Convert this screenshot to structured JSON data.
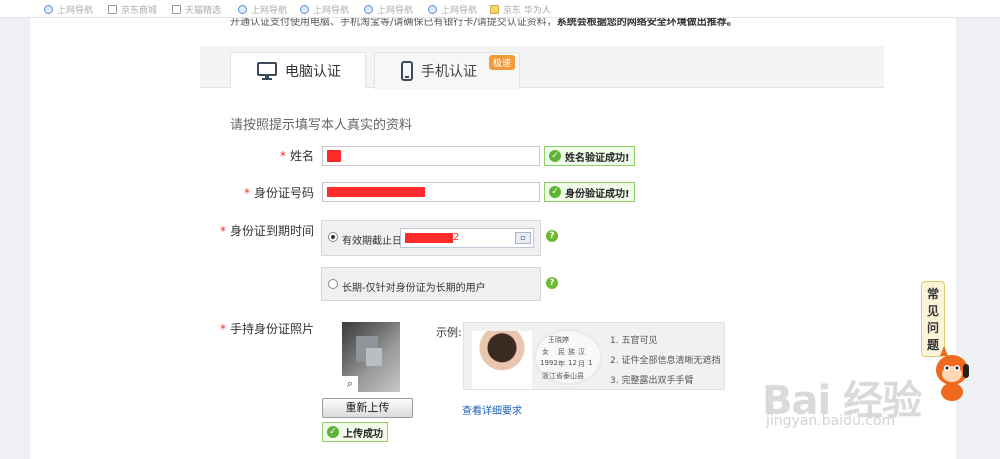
{
  "topbar": {
    "items": [
      "上网导航",
      "京东商城",
      "天猫精选",
      "上网导航",
      "上网导航",
      "上网导航",
      "上网导航",
      "京东 华为人"
    ]
  },
  "notice": {
    "text": "开通认证支付使用电脑、手机淘宝等/请确保已有银行卡/请提交认证资料，",
    "bold": "系统会根据您的网络安全环境做出推荐。"
  },
  "tabs": [
    {
      "label": "电脑认证",
      "icon": "monitor-icon",
      "active": true
    },
    {
      "label": "手机认证",
      "icon": "phone-icon",
      "active": false,
      "badge": "极速"
    }
  ],
  "form": {
    "intro": "请按照提示填写本人真实的资料",
    "name": {
      "label": "姓名",
      "required": "*",
      "status": "姓名验证成功!"
    },
    "id_number": {
      "label": "身份证号码",
      "required": "*",
      "status": "身份验证成功!"
    },
    "expiry": {
      "label": "身份证到期时间",
      "required": "*",
      "option_date": {
        "label": "有效期截止日",
        "selected": true,
        "suffix": "2"
      },
      "option_long": {
        "label": "长期-仅针对身份证为长期的用户",
        "selected": false
      },
      "help": "?"
    },
    "photo": {
      "label": "手持身份证照片",
      "required": "*",
      "reupload_button": "重新上传",
      "upload_status": "上传成功",
      "example_label": "示例:",
      "example_points": [
        "1. 五官可见",
        "2. 证件全部信息清晰无遮挡",
        "3. 完整露出双手手臂"
      ],
      "example_card": [
        "王晓婷",
        "女",
        "民",
        "族",
        "汉",
        "1992",
        "年",
        "12",
        "月",
        "1",
        "浙江省泰山县"
      ],
      "detail_link": "查看详细要求"
    }
  },
  "faq": {
    "label": [
      "常",
      "见",
      "问",
      "题"
    ]
  },
  "watermark": {
    "brand": "Bai  经验",
    "url": "jingyan.baidu.com"
  },
  "colors": {
    "success": "#5fb336",
    "required": "#e33333",
    "link": "#1a5fb4",
    "badge": "#f39b3c"
  }
}
